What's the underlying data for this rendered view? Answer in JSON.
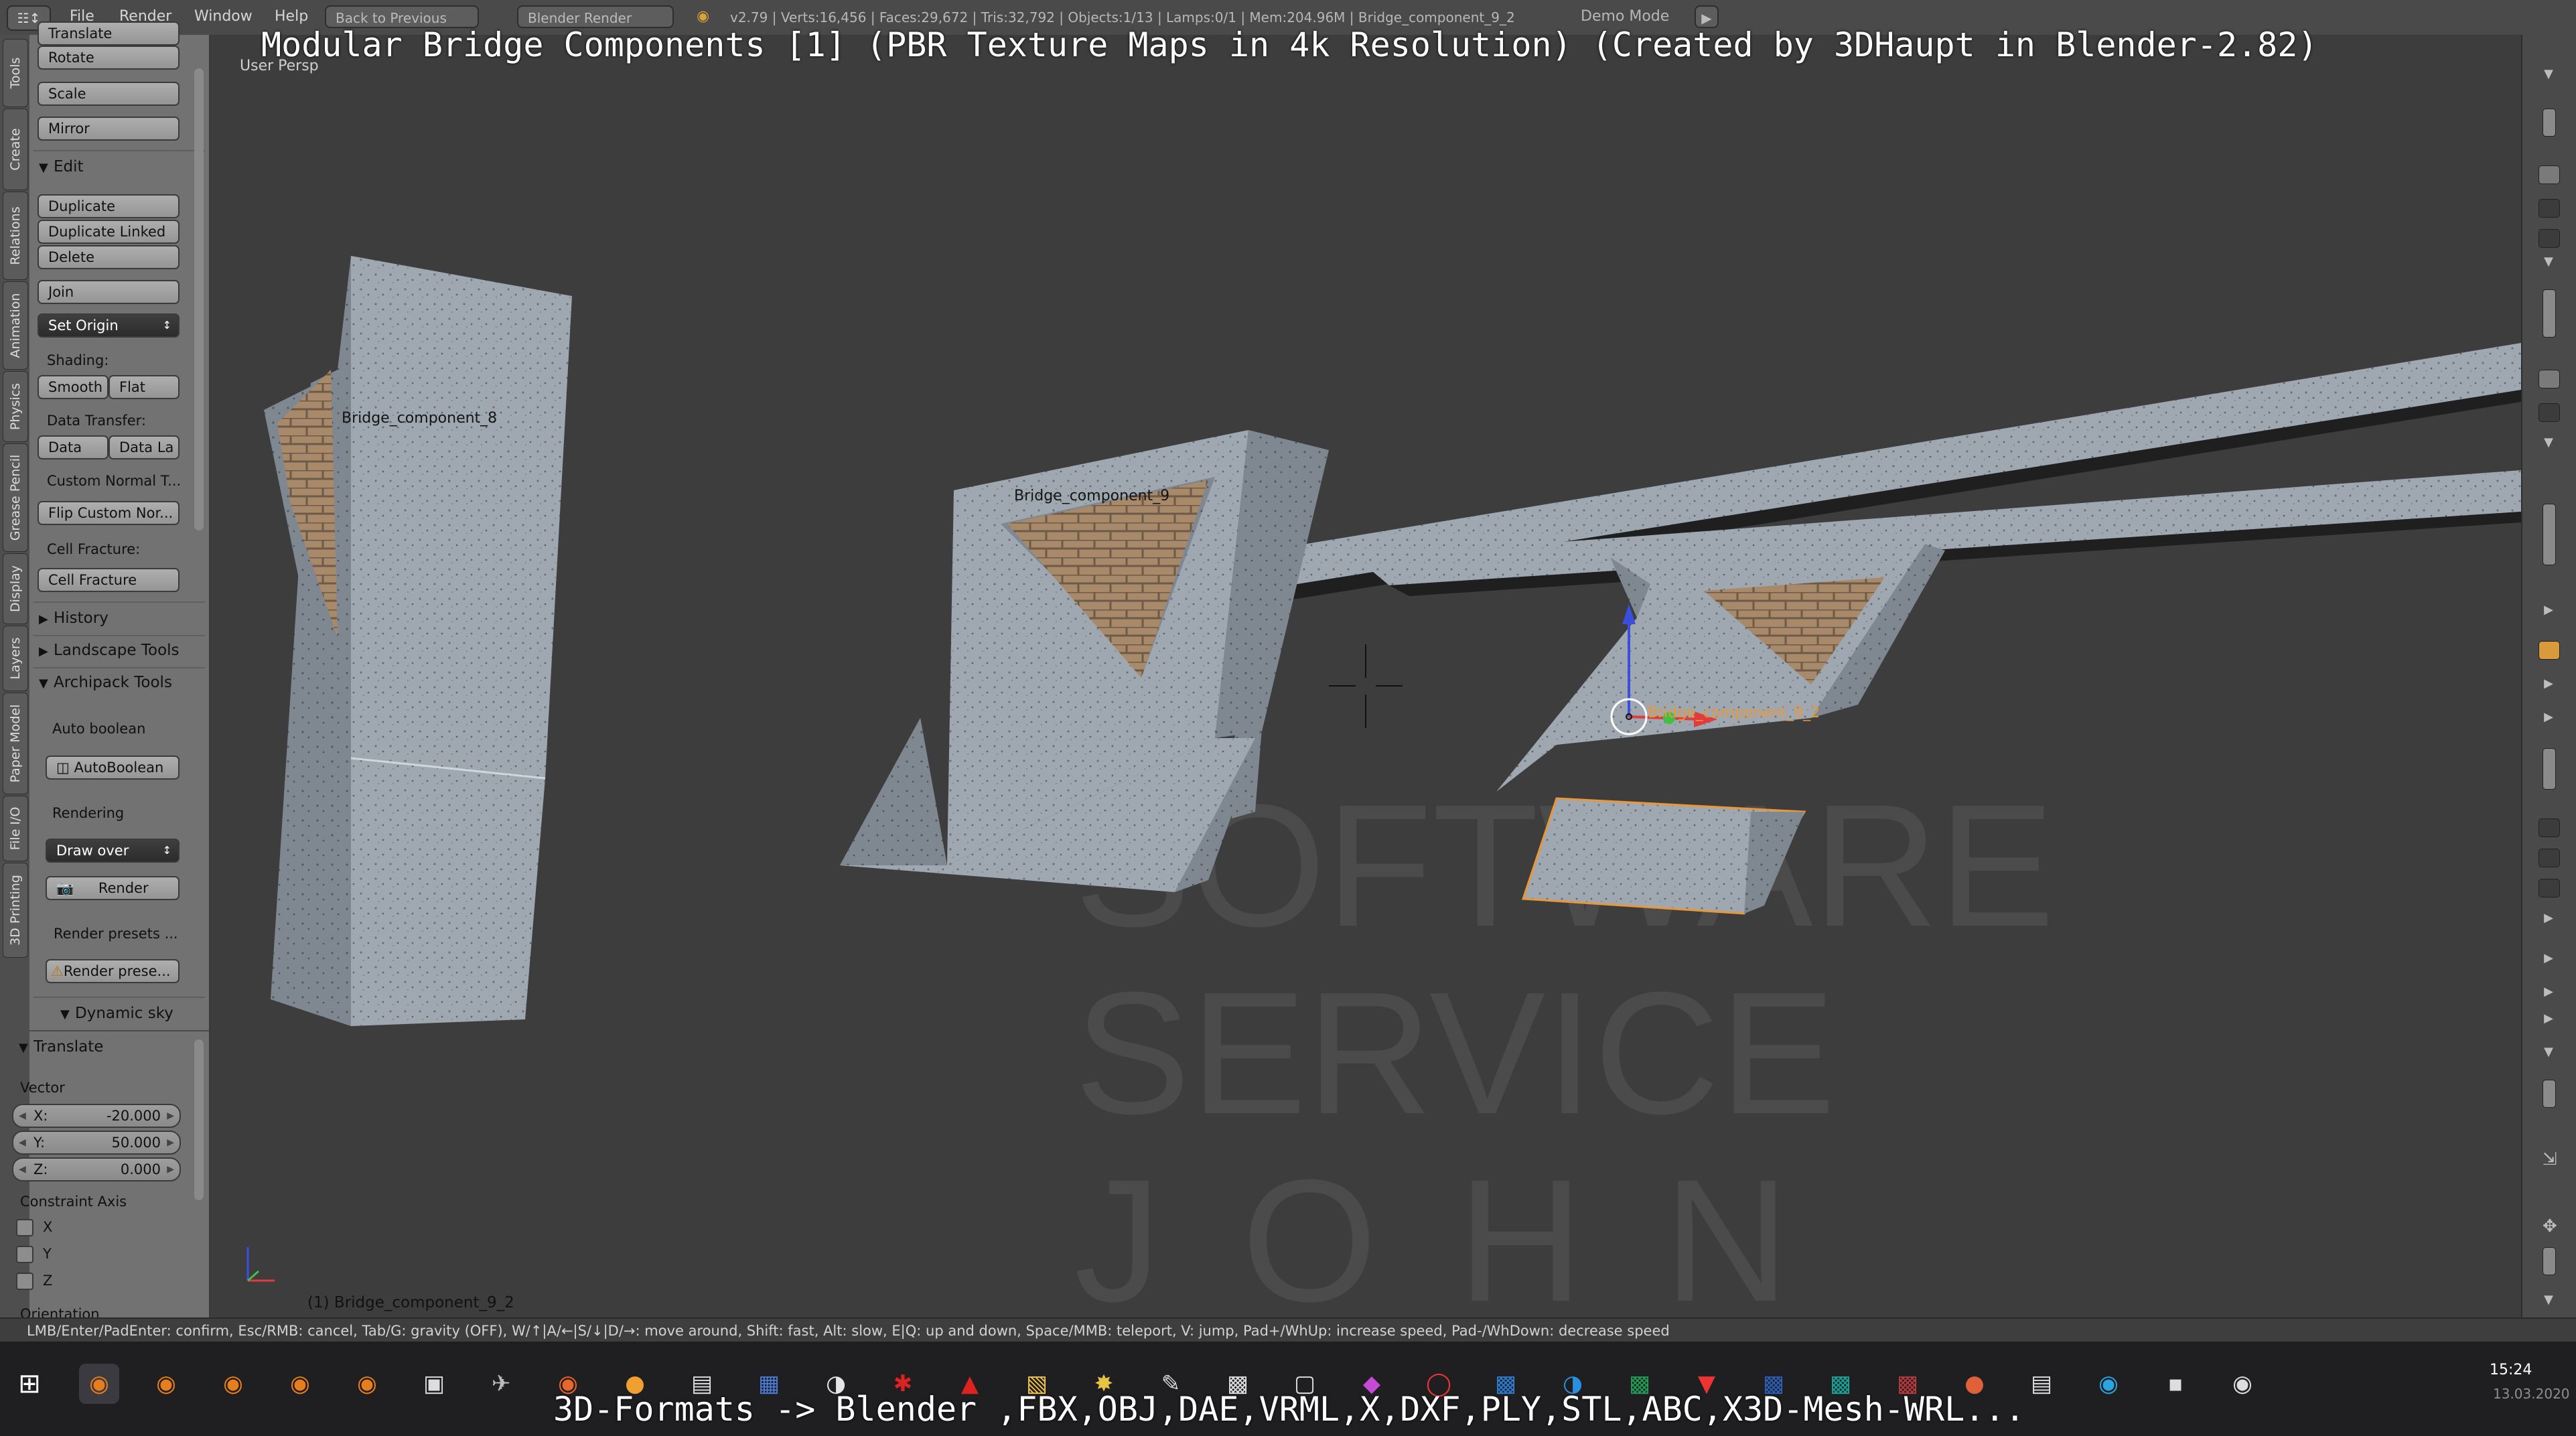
{
  "topbar": {
    "menus": [
      "File",
      "Render",
      "Window",
      "Help"
    ],
    "back_button": "Back to Previous",
    "render_engine": "Blender Render",
    "stats": "v2.79 | Verts:16,456 | Faces:29,672 | Tris:32,792 | Objects:1/13 | Lamps:0/1 | Mem:204.96M | Bridge_component_9_2",
    "demo_mode": "Demo Mode"
  },
  "overlay": {
    "title": "Modular Bridge Components [1] (PBR Texture Maps in 4k Resolution) (Created by 3DHaupt in Blender-2.82)",
    "formats": "3D-Formats -> Blender ,FBX,OBJ,DAE,VRML,X,DXF,PLY,STL,ABC,X3D-Mesh-WRL..."
  },
  "tabs": [
    "Tools",
    "Create",
    "Relations",
    "Animation",
    "Physics",
    "Grease Pencil",
    "Display",
    "Layers",
    "Paper Model",
    "File I/O",
    "3D Printing"
  ],
  "toolshelf": {
    "transform": {
      "translate": "Translate",
      "rotate": "Rotate",
      "scale": "Scale",
      "mirror": "Mirror"
    },
    "edit": {
      "header": "Edit",
      "duplicate": "Duplicate",
      "duplicate_linked": "Duplicate Linked",
      "delete": "Delete",
      "join": "Join",
      "set_origin": "Set Origin",
      "shading_label": "Shading:",
      "smooth": "Smooth",
      "flat": "Flat",
      "data_transfer_label": "Data Transfer:",
      "data": "Data",
      "data_layout": "Data La",
      "custom_normal": "Custom Normal T...",
      "flip_custom_normals": "Flip Custom Nor...",
      "cell_fracture_label": "Cell Fracture:",
      "cell_fracture": "Cell Fracture"
    },
    "history": "History",
    "landscape_tools": "Landscape Tools",
    "archipack": {
      "header": "Archipack Tools",
      "auto_boolean_label": "Auto boolean",
      "auto_boolean_button": "AutoBoolean",
      "rendering_label": "Rendering",
      "draw_over": "Draw over",
      "render": "Render",
      "render_presets_label": "Render presets ...",
      "render_presets_button": "Render prese..."
    },
    "dynamic_sky": "Dynamic sky",
    "operator": {
      "header": "Translate",
      "vector_label": "Vector",
      "x": {
        "label": "X:",
        "value": "-20.000"
      },
      "y": {
        "label": "Y:",
        "value": "50.000"
      },
      "z": {
        "label": "Z:",
        "value": "0.000"
      },
      "constraint_label": "Constraint Axis",
      "cx": "X",
      "cy": "Y",
      "cz": "Z",
      "orientation": "Orientation"
    }
  },
  "viewport": {
    "view_name": "User Persp",
    "objects": [
      "Bridge_component_8",
      "Bridge_component_9",
      "Bridge_component_9_2"
    ],
    "status": "(1) Bridge_component_9_2",
    "watermark": [
      "SOFTWARE",
      "SERVICE",
      "JOHN"
    ]
  },
  "statusbar": "LMB/Enter/PadEnter: confirm, Esc/RMB: cancel, Tab/G: gravity (OFF), W/↑|A/←|S/↓|D/→: move around, Shift: fast, Alt: slow, E|Q: up and down, Space/MMB: teleport, V: jump, Pad+/WhUp: increase speed, Pad-/WhDown: decrease speed",
  "taskbar": {
    "time": "15:24",
    "date": "13.03.2020"
  },
  "colors": {
    "viewport_bg": "#3d3d3d",
    "concrete": "#9fa8b0",
    "brick": "#a8896a",
    "selection_outline": "#e8973a",
    "axis_x": "#e23b3b",
    "axis_y": "#43c043",
    "axis_z": "#3a4fe0"
  }
}
